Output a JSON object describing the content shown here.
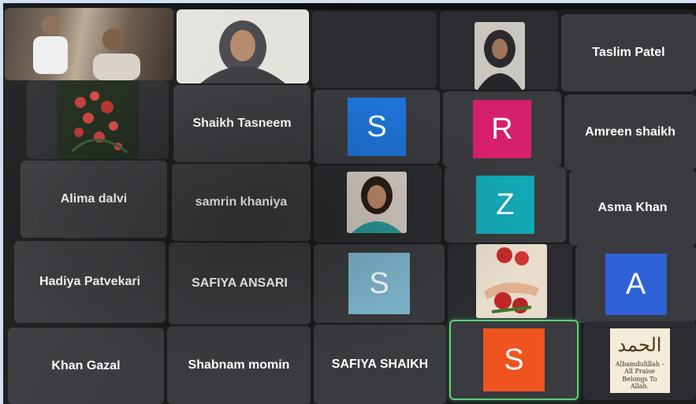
{
  "participants": [
    {
      "name": "Taslim Patel"
    },
    {
      "name": "Shaikh Tasneem"
    },
    {
      "avatar_letter": "S",
      "color": "#1f74d6"
    },
    {
      "avatar_letter": "R",
      "color": "#d61f6b"
    },
    {
      "name": "Amreen shaikh"
    },
    {
      "name": "Alima dalvi"
    },
    {
      "name": "samrin khaniya"
    },
    {
      "avatar_letter": "Z",
      "color": "#13a8b5"
    },
    {
      "name": "Asma Khan"
    },
    {
      "name": "Hadiya Patvekari"
    },
    {
      "name": "SAFIYA ANSARI"
    },
    {
      "avatar_letter": "S",
      "color": "#7fb8cf"
    },
    {
      "avatar_letter": "A",
      "color": "#2f62d6"
    },
    {
      "name": "Khan Gazal"
    },
    {
      "name": "Shabnam momin"
    },
    {
      "name": "SAFIYA SHAIKH"
    },
    {
      "avatar_letter": "S",
      "color": "#f0541e"
    }
  ],
  "calligraphy_caption": "Albamdulillah - All Praise Belongs To Allah.",
  "active_speaker_color": "#5fd07a"
}
